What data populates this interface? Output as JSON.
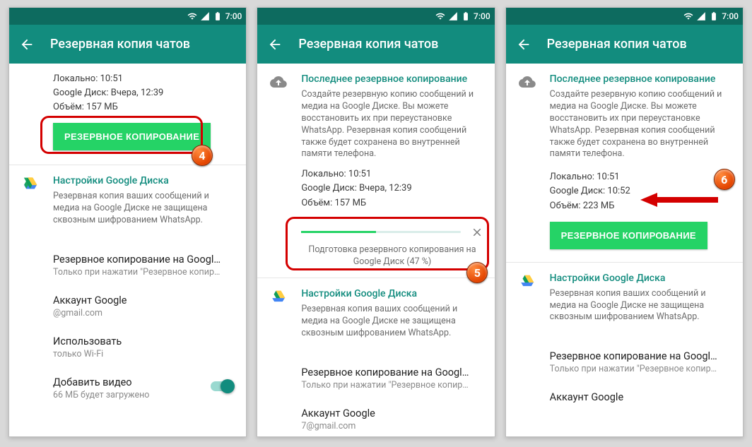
{
  "statusbar": {
    "time": "7:00"
  },
  "appbar": {
    "title": "Резервная копия чатов"
  },
  "last_backup_header": "Последнее резервное копирование",
  "last_backup_desc": "Создайте резервную копию сообщений и медиа на Google Диске. Вы можете восстановить их при переустановке WhatsApp. Резервная копия сообщений также будет сохранена во внутренней памяти телефона.",
  "screen1": {
    "local": "Локально: 10:51",
    "gdrive": "Google Диск: Вчера, 12:39",
    "size": "Объём: 157 МБ",
    "button": "РЕЗЕРВНОЕ КОПИРОВАНИЕ",
    "gdrive_settings": "Настройки Google Диска",
    "gdrive_desc": "Резервная копия ваших сообщений и медиа на Google Диске не защищена сквозным шифрованием WhatsApp.",
    "opt_target": "Резервное копирование на Googl…",
    "opt_target_sub": "Только при нажатии \"Резервное копир…",
    "opt_account": "Аккаунт Google",
    "opt_account_sub": "@gmail.com",
    "opt_network": "Использовать",
    "opt_network_sub": "только Wi-Fi",
    "opt_video": "Добавить видео",
    "opt_video_sub": "66 МБ будет загружено"
  },
  "screen2": {
    "local": "Локально: 10:51",
    "gdrive": "Google Диск: Вчера, 12:39",
    "size": "Объём: 157 МБ",
    "progress_text": "Подготовка резервного копирования на Google Диск (47 %)",
    "progress_pct": 47,
    "gdrive_settings": "Настройки Google Диска",
    "gdrive_desc": "Резервная копия ваших сообщений и медиа на Google Диске не защищена сквозным шифрованием WhatsApp.",
    "opt_target": "Резервное копирование на Googl…",
    "opt_target_sub": "Только при нажатии \"Резервное копир…",
    "opt_account": "Аккаунт Google",
    "opt_account_sub": "7@gmail.com"
  },
  "screen3": {
    "local": "Локально: 10:51",
    "gdrive": "Google Диск: 10:52",
    "size": "Объём: 223 МБ",
    "button": "РЕЗЕРВНОЕ КОПИРОВАНИЕ",
    "gdrive_settings": "Настройки Google Диска",
    "gdrive_desc": "Резервная копия ваших сообщений и медиа на Google Диске не защищена сквозным шифрованием WhatsApp.",
    "opt_target": "Резервное копирование на Googl…",
    "opt_target_sub": "Только при нажатии \"Резервное копир…",
    "opt_account": "Аккаунт Google"
  },
  "annotations": {
    "badge4": "4",
    "badge5": "5",
    "badge6": "6"
  }
}
